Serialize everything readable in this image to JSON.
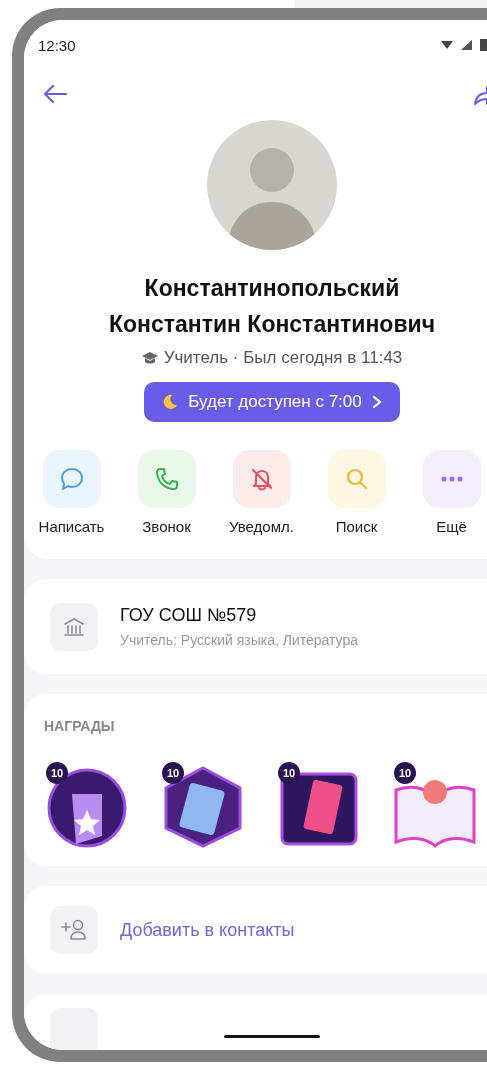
{
  "status_bar": {
    "time": "12:30"
  },
  "profile": {
    "name_lines": [
      "Константинопольский",
      "Константин Константинович"
    ],
    "status": "Учитель · Был сегодня в 11:43",
    "availability": "Будет доступен с 7:00"
  },
  "actions": [
    {
      "kind": "message",
      "label": "Написать"
    },
    {
      "kind": "call",
      "label": "Звонок"
    },
    {
      "kind": "mute",
      "label": "Уведомл."
    },
    {
      "kind": "search",
      "label": "Поиск"
    },
    {
      "kind": "more",
      "label": "Ещё"
    }
  ],
  "organization": {
    "title": "ГОУ СОШ №579",
    "subtitle": "Учитель: Русский языка, Литература"
  },
  "awards": {
    "title": "НАГРАДЫ",
    "items": [
      {
        "kind": "star-card",
        "count": "10"
      },
      {
        "kind": "book-hands",
        "count": "10"
      },
      {
        "kind": "red-book",
        "count": "10"
      },
      {
        "kind": "idea-book",
        "count": "10"
      }
    ]
  },
  "add_contact": {
    "label": "Добавить в контакты"
  }
}
